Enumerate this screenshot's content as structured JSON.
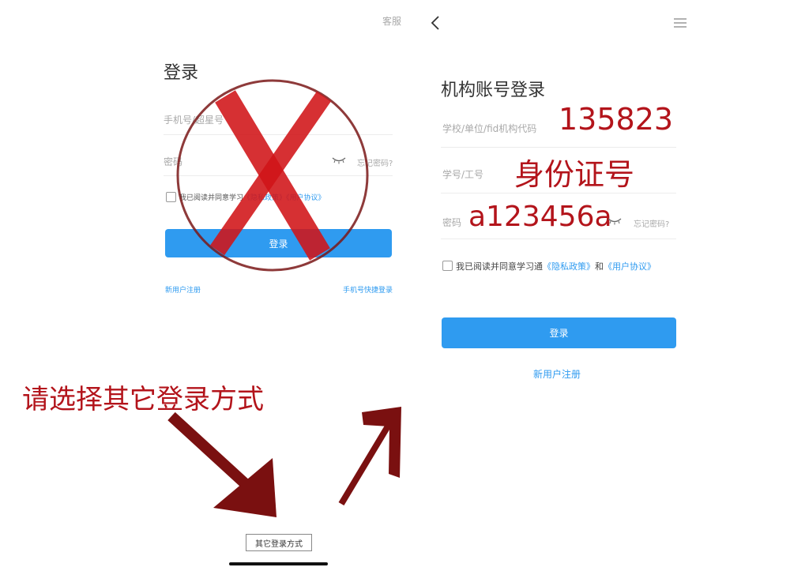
{
  "left_screen": {
    "customer_service": "客服",
    "title": "登录",
    "phone_placeholder": "手机号/超星号",
    "password_placeholder": "密码",
    "forgot_password": "忘记密码?",
    "agreement_prefix": "我已阅读并同意学习",
    "agreement_privacy": "《隐私政策》",
    "agreement_user": "《用户协议》",
    "login_button": "登录",
    "register_link": "新用户注册",
    "quick_login_link": "手机号快捷登录",
    "other_login_button": "其它登录方式"
  },
  "right_screen": {
    "title": "机构账号登录",
    "org_code_placeholder": "学校/单位/fid机构代码",
    "student_id_placeholder": "学号/工号",
    "password_placeholder": "密码",
    "forgot_password": "忘记密码?",
    "agreement_prefix": "我已阅读并同意学习通",
    "agreement_privacy": "《隐私政策》",
    "agreement_and": "和",
    "agreement_user": "《用户协议》",
    "login_button": "登录",
    "register_link": "新用户注册"
  },
  "annotations": {
    "org_code_value": "135823",
    "student_id_value": "身份证号",
    "password_value": "a123456a",
    "instruction": "请选择其它登录方式",
    "color": "#b3141b"
  },
  "icons": [
    "back-arrow-icon",
    "menu-icon",
    "eye-closed-icon",
    "cross-out-mark-icon",
    "arrow-down-right-icon",
    "arrow-up-right-icon"
  ]
}
